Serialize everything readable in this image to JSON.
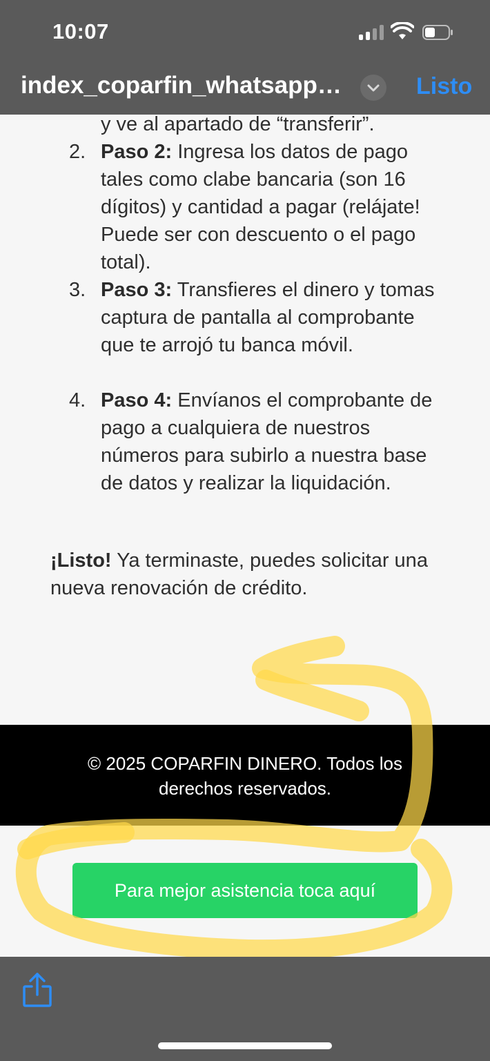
{
  "status_bar": {
    "time": "10:07"
  },
  "nav": {
    "title": "index_coparfin_whatsapp_...",
    "done_label": "Listo",
    "accent_color": "#2e8df5"
  },
  "content": {
    "continued_line": "y ve al apartado de “transferir”.",
    "steps": [
      {
        "number": "2.",
        "label": "Paso 2:",
        "text": " Ingresa los datos de pago tales como clabe bancaria (son 16 dígitos) y cantidad a pagar (relájate! Puede ser con descuento o el pago total)."
      },
      {
        "number": "3.",
        "label": "Paso 3:",
        "text": " Transfieres el dinero y tomas captura de pantalla al comprobante que te arrojó tu banca móvil."
      },
      {
        "number": "4.",
        "label": "Paso 4:",
        "text": " Envíanos el comprobante de pago a cualquiera de nuestros números para subirlo a nuestra base de datos y realizar la liquidación."
      }
    ],
    "done_bold": "¡Listo!",
    "done_text": " Ya terminaste, puedes solicitar una nueva renovación de crédito."
  },
  "footer": {
    "text": "© 2025 COPARFIN DINERO. Todos los derechos reservados."
  },
  "whatsapp_button": {
    "label": "Para mejor asistencia toca aquí",
    "color": "#27d366"
  },
  "toolbar": {
    "share_icon": "share-icon"
  },
  "annotation": {
    "color": "#ffd84a"
  }
}
